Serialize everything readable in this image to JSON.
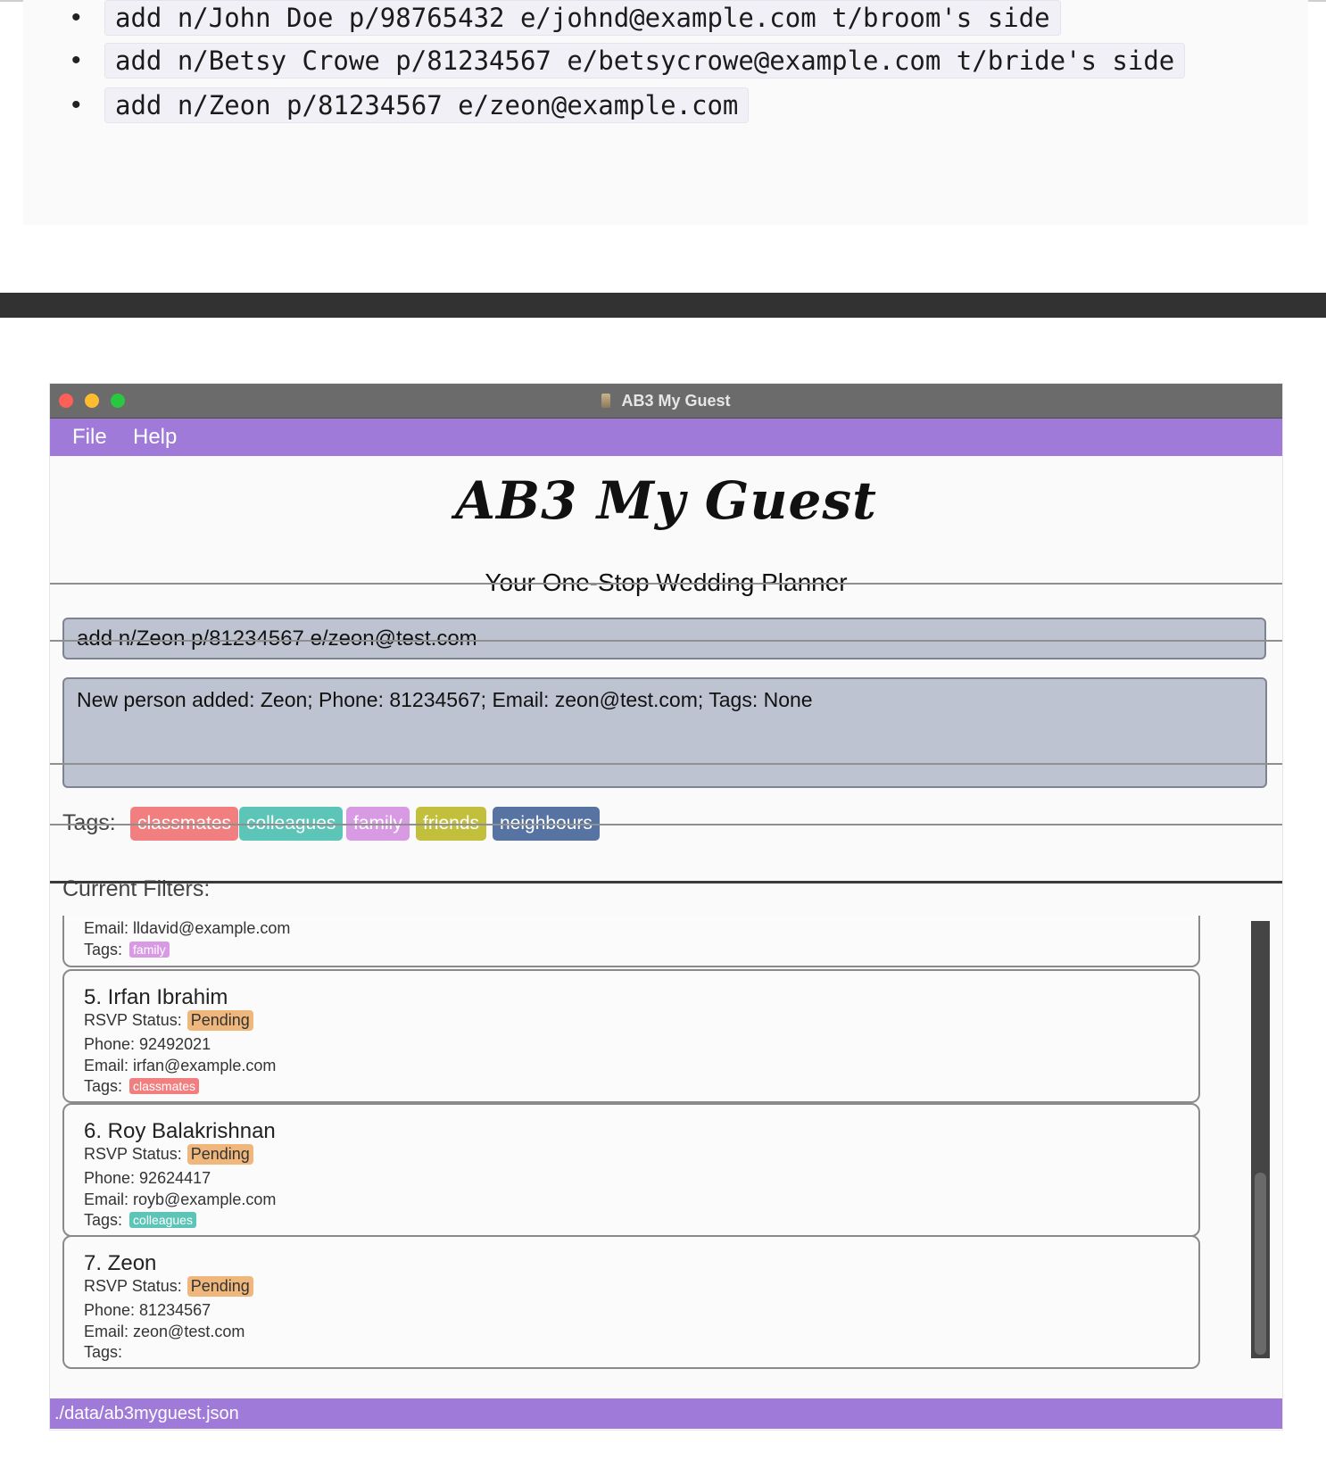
{
  "doc": {
    "examples": [
      "add n/John Doe p/98765432 e/johnd@example.com t/broom's side",
      "add n/Betsy Crowe p/81234567 e/betsycrowe@example.com t/bride's side",
      "add n/Zeon p/81234567 e/zeon@example.com"
    ]
  },
  "window": {
    "title": "AB3 My Guest"
  },
  "menu": {
    "file": "File",
    "help": "Help"
  },
  "header": {
    "logo": "AB3 My Guest",
    "subtitle": "Your One-Stop Wedding Planner"
  },
  "command": {
    "value": "add n/Zeon p/81234567 e/zeon@test.com"
  },
  "result": {
    "text": "New person added: Zeon; Phone: 81234567; Email: zeon@test.com; Tags: None"
  },
  "tags": {
    "label": "Tags:",
    "items": [
      {
        "name": "classmates",
        "color": "#f27f7f"
      },
      {
        "name": "colleagues",
        "color": "#5cc5b8"
      },
      {
        "name": "family",
        "color": "#d79ae3"
      },
      {
        "name": "friends",
        "color": "#c2bf3d"
      },
      {
        "name": "neighbours",
        "color": "#5673a1"
      }
    ]
  },
  "filters": {
    "label": "Current Filters:"
  },
  "persons": {
    "partial": {
      "email": "Email: lldavid@example.com",
      "tags_label": "Tags:",
      "tag": "family",
      "tag_color": "#d79ae3"
    },
    "items": [
      {
        "name": "5. Irfan Ibrahim",
        "rsvp_label": "RSVP Status:",
        "rsvp": "Pending",
        "phone": "Phone: 92492021",
        "email": "Email: irfan@example.com",
        "tags_label": "Tags:",
        "tag": "classmates",
        "tag_color": "#f27f7f"
      },
      {
        "name": "6. Roy Balakrishnan",
        "rsvp_label": "RSVP Status:",
        "rsvp": "Pending",
        "phone": "Phone: 92624417",
        "email": "Email: royb@example.com",
        "tags_label": "Tags:",
        "tag": "colleagues",
        "tag_color": "#5cc5b8"
      },
      {
        "name": "7. Zeon",
        "rsvp_label": "RSVP Status:",
        "rsvp": "Pending",
        "phone": "Phone: 81234567",
        "email": "Email: zeon@test.com",
        "tags_label": "Tags:",
        "tag": "",
        "tag_color": ""
      }
    ]
  },
  "status": {
    "path": "./data/ab3myguest.json"
  },
  "colors": {
    "accent": "#a07ad8",
    "rsvp_pending": "#f0b77d"
  }
}
